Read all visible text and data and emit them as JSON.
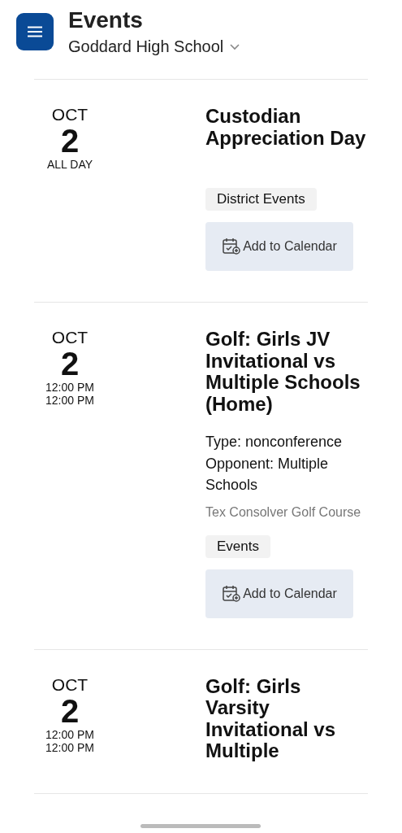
{
  "header": {
    "title": "Events",
    "school": "Goddard High School"
  },
  "events": [
    {
      "month": "OCT",
      "day": "2",
      "times": [
        "ALL DAY"
      ],
      "title": "Custodian Appreciation Day",
      "tag": "District Events",
      "button": "Add to Calendar"
    },
    {
      "month": "OCT",
      "day": "2",
      "times": [
        "12:00 PM",
        "12:00 PM"
      ],
      "title": "Golf: Girls JV Invitational vs Multiple Schools (Home)",
      "details": [
        "Type: nonconference",
        "Opponent: Multiple Schools"
      ],
      "location": "Tex Consolver Golf Course",
      "tag": "Events",
      "button": "Add to Calendar"
    },
    {
      "month": "OCT",
      "day": "2",
      "times": [
        "12:00 PM",
        "12:00 PM"
      ],
      "title": "Golf: Girls Varsity Invitational vs Multiple"
    }
  ]
}
